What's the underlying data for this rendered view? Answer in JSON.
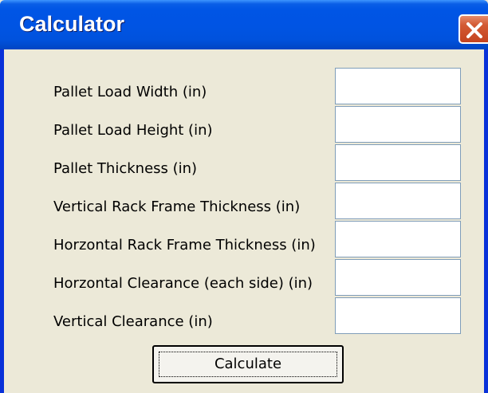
{
  "window": {
    "title": "Calculator",
    "close_icon": "close-icon"
  },
  "form": {
    "fields": [
      {
        "label": "Pallet Load Width (in)",
        "value": ""
      },
      {
        "label": "Pallet Load Height (in)",
        "value": ""
      },
      {
        "label": "Pallet Thickness (in)",
        "value": ""
      },
      {
        "label": "Vertical Rack Frame Thickness (in)",
        "value": ""
      },
      {
        "label": "Horzontal Rack Frame Thickness (in)",
        "value": ""
      },
      {
        "label": "Horzontal Clearance (each side) (in)",
        "value": ""
      },
      {
        "label": "Vertical Clearance (in)",
        "value": ""
      }
    ],
    "calculate_label": "Calculate"
  },
  "colors": {
    "titlebar": "#0054e3",
    "close_button": "#d35a33",
    "window_background": "#ece9d8",
    "input_border": "#7f9db9"
  }
}
